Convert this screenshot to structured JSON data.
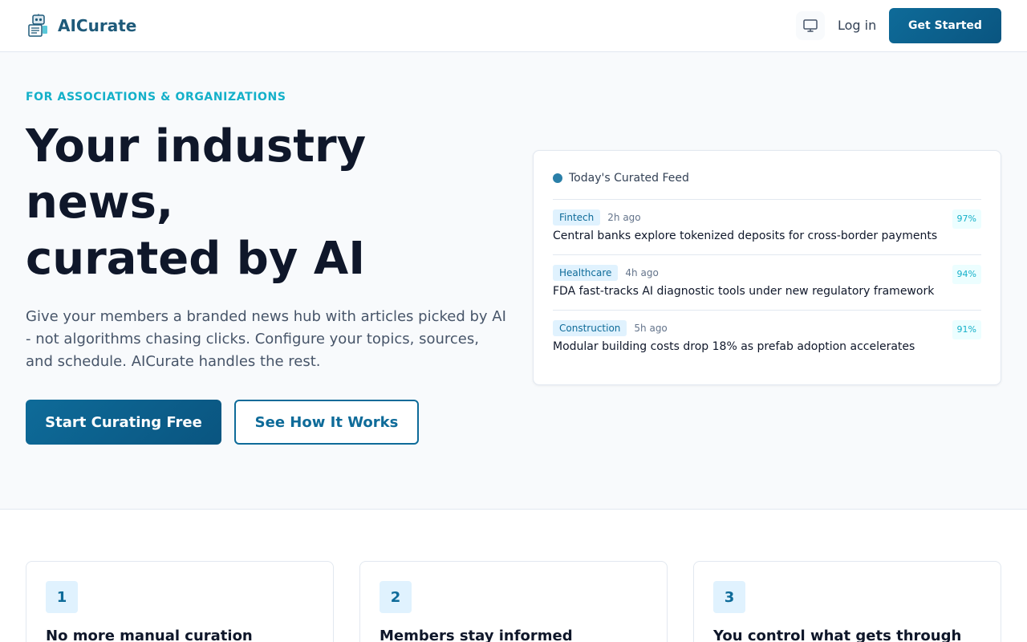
{
  "brand": {
    "name": "AICurate"
  },
  "nav": {
    "login": "Log in",
    "cta": "Get Started"
  },
  "hero": {
    "eyebrow": "FOR ASSOCIATIONS & ORGANIZATIONS",
    "title_line1": "Your industry",
    "title_line2": "news,",
    "title_line3": "curated by AI",
    "subtitle": "Give your members a branded news hub with articles picked by AI - not algorithms chasing clicks. Configure your topics, sources, and schedule. AICurate handles the rest.",
    "primary_cta": "Start Curating Free",
    "secondary_cta": "See How It Works"
  },
  "feed": {
    "title": "Today's Curated Feed",
    "items": [
      {
        "tag": "Fintech",
        "time": "2h ago",
        "headline": "Central banks explore tokenized deposits for cross-border payments",
        "score": "97%"
      },
      {
        "tag": "Healthcare",
        "time": "4h ago",
        "headline": "FDA fast-tracks AI diagnostic tools under new regulatory framework",
        "score": "94%"
      },
      {
        "tag": "Construction",
        "time": "5h ago",
        "headline": "Modular building costs drop 18% as prefab adoption accelerates",
        "score": "91%"
      }
    ]
  },
  "features": [
    {
      "number": "1",
      "title": "No more manual curation"
    },
    {
      "number": "2",
      "title": "Members stay informed"
    },
    {
      "number": "3",
      "title": "You control what gets through"
    }
  ],
  "icons": {
    "logo": "robot-newspaper-icon",
    "theme": "monitor-icon"
  },
  "colors": {
    "brand": "#0e6b99",
    "accent": "#14b0c9",
    "text": "#0f172a"
  }
}
